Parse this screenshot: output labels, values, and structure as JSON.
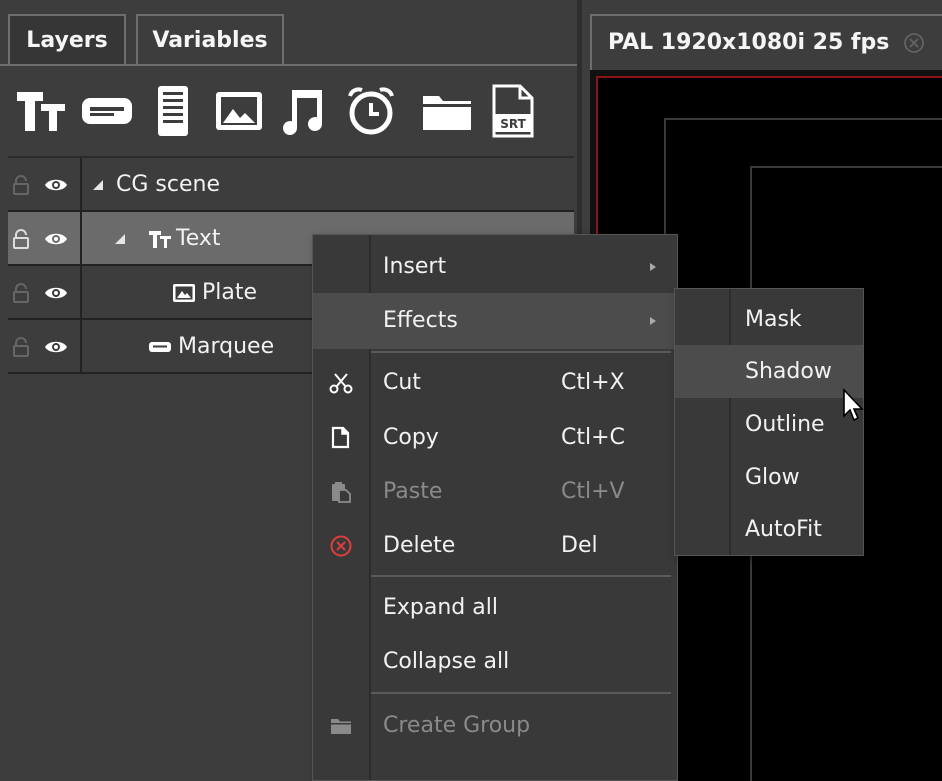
{
  "left_panel": {
    "tabs": [
      {
        "label": "Layers"
      },
      {
        "label": "Variables"
      }
    ],
    "toolbar": [
      {
        "icon": "text-layer-icon"
      },
      {
        "icon": "marquee-layer-icon"
      },
      {
        "icon": "roll-layer-icon"
      },
      {
        "icon": "image-layer-icon"
      },
      {
        "icon": "audio-layer-icon"
      },
      {
        "icon": "clock-layer-icon"
      },
      {
        "icon": "folder-icon"
      },
      {
        "icon": "srt-subtitle-icon",
        "badge": "SRT"
      }
    ],
    "tree": [
      {
        "label": "CG scene",
        "icon": "collapse-triangle-icon"
      },
      {
        "label": "Text",
        "icon": "text-layer-icon"
      },
      {
        "label": "Plate",
        "icon": "image-layer-icon"
      },
      {
        "label": "Marquee",
        "icon": "marquee-layer-icon"
      }
    ]
  },
  "right_panel": {
    "doc_tab": {
      "label": "PAL 1920x1080i 25 fps",
      "close_icon": "close-circle-icon"
    }
  },
  "context_menu": {
    "items": [
      {
        "label": "Insert",
        "submenu": true
      },
      {
        "label": "Effects",
        "submenu": true
      },
      {
        "label": "Cut",
        "shortcut": "Ctl+X",
        "icon": "scissors-icon"
      },
      {
        "label": "Copy",
        "shortcut": "Ctl+C",
        "icon": "copy-icon"
      },
      {
        "label": "Paste",
        "shortcut": "Ctl+V",
        "icon": "paste-icon",
        "disabled": true
      },
      {
        "label": "Delete",
        "shortcut": "Del",
        "icon": "delete-icon"
      },
      {
        "label": "Expand all"
      },
      {
        "label": "Collapse all"
      },
      {
        "label": "Create Group",
        "icon": "folder-icon",
        "disabled": true
      }
    ]
  },
  "effects_submenu": {
    "items": [
      {
        "label": "Mask"
      },
      {
        "label": "Shadow"
      },
      {
        "label": "Outline"
      },
      {
        "label": "Glow"
      },
      {
        "label": "AutoFit"
      }
    ]
  },
  "colors": {
    "panel_bg": "#3d3d3d",
    "selected_row": "#6b6b6b",
    "menu_bg": "#393939",
    "menu_hover": "#4c4c4c",
    "delete_red": "#e03c3c",
    "canvas_border_red": "#8a1414"
  }
}
